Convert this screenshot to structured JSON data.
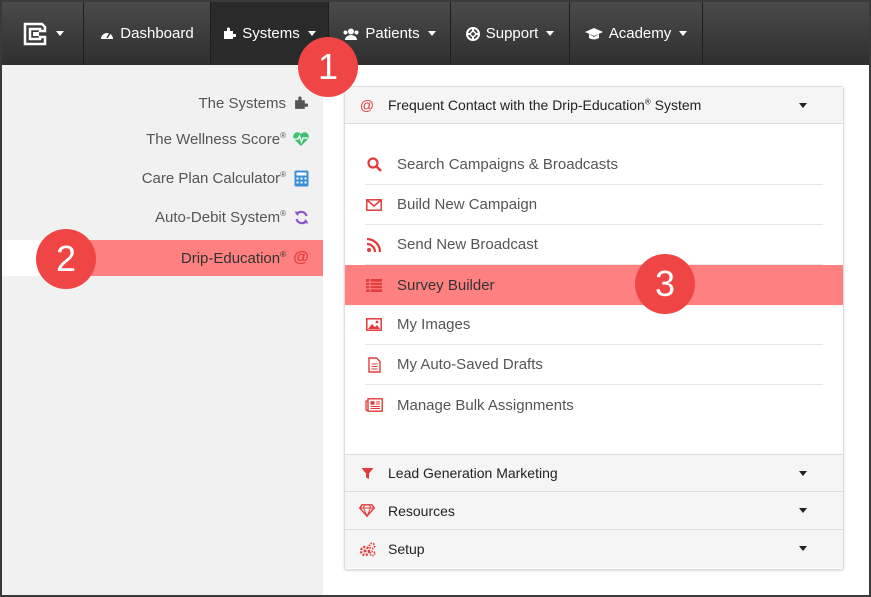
{
  "navbar": {
    "items": [
      {
        "label": "",
        "icon": "logo-icon"
      },
      {
        "label": "Dashboard",
        "icon": "dashboard-icon"
      },
      {
        "label": "Systems",
        "icon": "puzzle-icon"
      },
      {
        "label": "Patients",
        "icon": "users-icon"
      },
      {
        "label": "Support",
        "icon": "lifebuoy-icon"
      },
      {
        "label": "Academy",
        "icon": "graduation-cap-icon"
      }
    ]
  },
  "sidebar": {
    "items": [
      {
        "label": "The Systems",
        "reg": "",
        "icon": "puzzle-icon",
        "color": "#555555"
      },
      {
        "label": "The Wellness Score",
        "reg": "®",
        "icon": "heartbeat-icon",
        "color": "#3fbf6f"
      },
      {
        "label": "Care Plan Calculator",
        "reg": "®",
        "icon": "calculator-icon",
        "color": "#3a8fd6"
      },
      {
        "label": "Auto-Debit System",
        "reg": "®",
        "icon": "refresh-icon",
        "color": "#8a55c8"
      },
      {
        "label": "Drip-Education",
        "reg": "®",
        "icon": "at-icon",
        "color": "#e33b3b"
      }
    ]
  },
  "panel": {
    "header": {
      "label": "Frequent Contact with the Drip-Education",
      "reg": "®",
      "suffix": " System"
    },
    "menu_items": [
      {
        "label": "Search Campaigns & Broadcasts",
        "icon": "search-icon"
      },
      {
        "label": "Build New Campaign",
        "icon": "envelope-icon"
      },
      {
        "label": "Send New Broadcast",
        "icon": "rss-icon"
      },
      {
        "label": "Survey Builder",
        "icon": "list-icon"
      },
      {
        "label": "My Images",
        "icon": "image-icon"
      },
      {
        "label": "My Auto-Saved Drafts",
        "icon": "file-icon"
      },
      {
        "label": "Manage Bulk Assignments",
        "icon": "newspaper-icon"
      }
    ],
    "sections": [
      {
        "label": "Lead Generation Marketing",
        "icon": "funnel-icon"
      },
      {
        "label": "Resources",
        "icon": "diamond-icon"
      },
      {
        "label": "Setup",
        "icon": "gears-icon"
      }
    ]
  },
  "callouts": [
    "1",
    "2",
    "3"
  ],
  "colors": {
    "accent": "#e33b3b",
    "highlight": "#fe8080",
    "callout": "#f04545",
    "navbar": "#3a3a3a"
  }
}
